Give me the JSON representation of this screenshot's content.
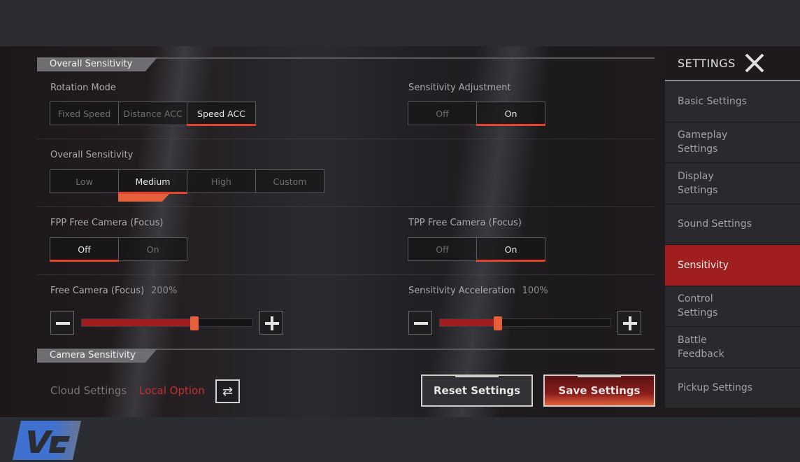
{
  "sections": {
    "overall": "Overall Sensitivity",
    "camera": "Camera Sensitivity"
  },
  "rotation_mode": {
    "label": "Rotation Mode",
    "options": [
      "Fixed Speed",
      "Distance ACC",
      "Speed ACC"
    ],
    "selected": "Speed ACC"
  },
  "sensitivity_adjustment": {
    "label": "Sensitivity Adjustment",
    "options": [
      "Off",
      "On"
    ],
    "selected": "On"
  },
  "overall_sensitivity": {
    "label": "Overall Sensitivity",
    "options": [
      "Low",
      "Medium",
      "High",
      "Custom"
    ],
    "selected": "Medium"
  },
  "fpp_free_camera": {
    "label": "FPP Free Camera (Focus)",
    "options": [
      "Off",
      "On"
    ],
    "selected": "Off"
  },
  "tpp_free_camera": {
    "label": "TPP Free Camera (Focus)",
    "options": [
      "Off",
      "On"
    ],
    "selected": "On"
  },
  "free_camera_slider": {
    "label": "Free Camera (Focus)",
    "value_text": "200%",
    "fraction": 0.66
  },
  "sensitivity_acceleration_slider": {
    "label": "Sensitivity Acceleration",
    "value_text": "100%",
    "fraction": 0.34
  },
  "footer": {
    "cloud_label": "Cloud Settings",
    "local_label": "Local Option",
    "swap_icon": "⇄",
    "reset_label": "Reset Settings",
    "save_label": "Save Settings"
  },
  "sidebar": {
    "title": "SETTINGS",
    "items": [
      {
        "label": "Basic Settings",
        "active": false
      },
      {
        "label": "Gameplay Settings",
        "active": false
      },
      {
        "label": "Display Settings",
        "active": false
      },
      {
        "label": "Sound Settings",
        "active": false
      },
      {
        "label": "Sensitivity",
        "active": true
      },
      {
        "label": "Control Settings",
        "active": false
      },
      {
        "label": "Battle Feedback",
        "active": false
      },
      {
        "label": "Pickup Settings",
        "active": false
      }
    ]
  },
  "colors": {
    "accent_red": "#a01e1e",
    "accent_orange": "#e4603a",
    "logo_blue": "#3f72d0"
  }
}
